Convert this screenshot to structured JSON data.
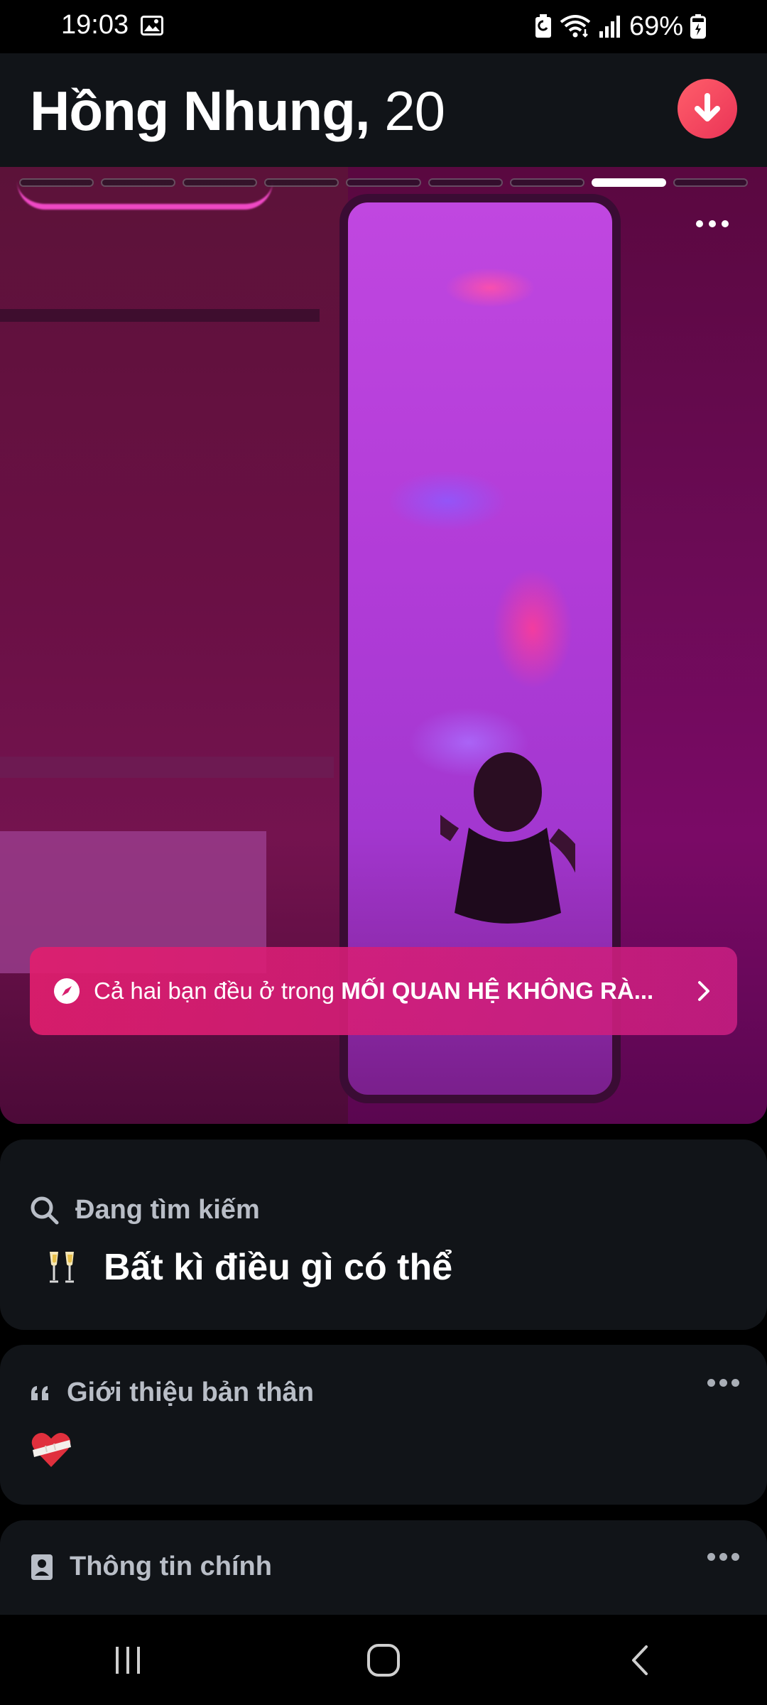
{
  "status_bar": {
    "time": "19:03",
    "battery": "69%"
  },
  "header": {
    "name": "Hồng Nhung,",
    "age": "20"
  },
  "photo": {
    "total": 9,
    "active_index": 7
  },
  "banner": {
    "prefix": "Cả hai bạn đều ở trong ",
    "highlight": "MỐI QUAN HỆ KHÔNG RÀ..."
  },
  "looking_for": {
    "label": "Đang tìm kiếm",
    "value": "Bất kì điều gì có thể"
  },
  "about": {
    "label": "Giới thiệu bản thân"
  },
  "basics": {
    "label": "Thông tin chính"
  },
  "colors": {
    "accent": "#ea3457",
    "card_bg": "#111418"
  }
}
